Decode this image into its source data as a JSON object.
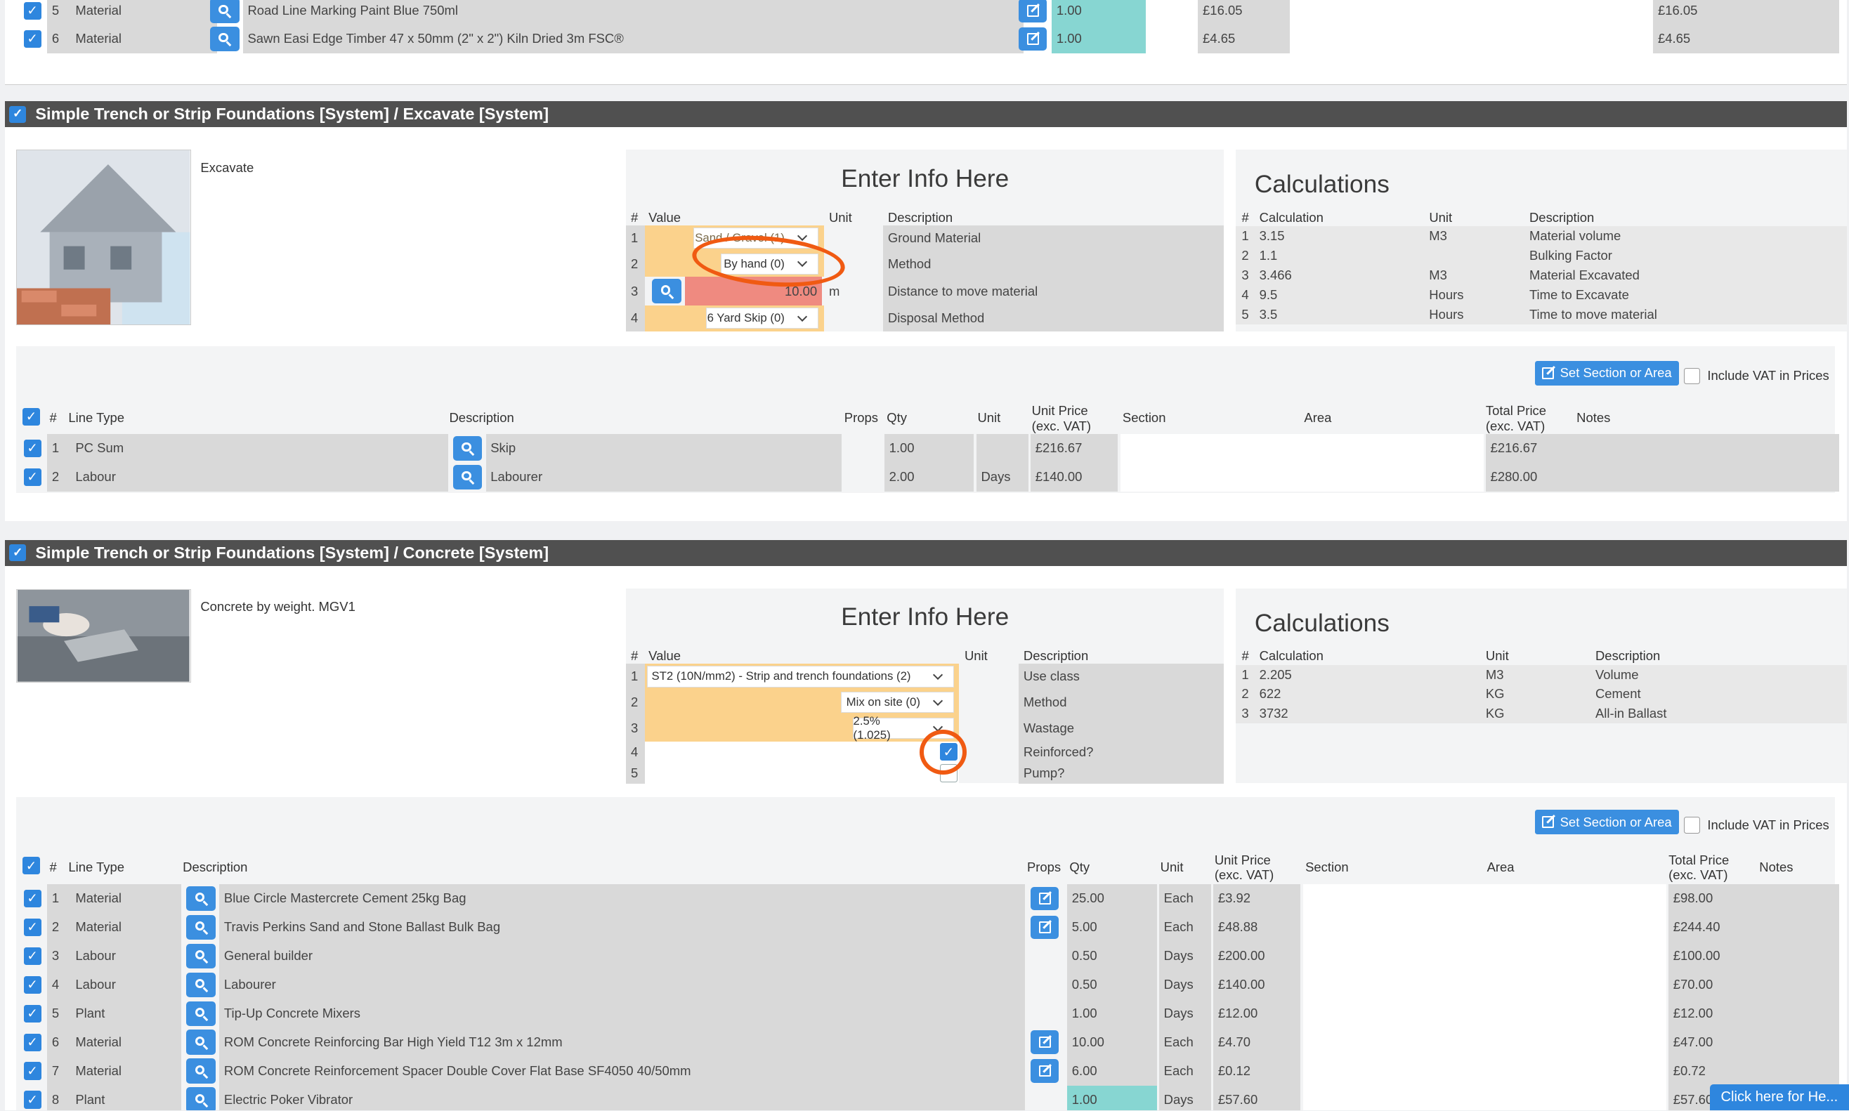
{
  "top_rows": [
    {
      "num": "5",
      "type": "Material",
      "desc": "Road Line Marking Paint Blue 750ml",
      "qty": "1.00",
      "unit_price": "£16.05",
      "total": "£16.05"
    },
    {
      "num": "6",
      "type": "Material",
      "desc": "Sawn Easi Edge Timber 47 x 50mm (2\" x 2\") Kiln Dried 3m FSC®",
      "qty": "1.00",
      "unit_price": "£4.65",
      "total": "£4.65"
    }
  ],
  "sections": [
    {
      "title": "Simple Trench or Strip Foundations [System] / Excavate [System]",
      "caption": "Excavate",
      "info_title": "Enter Info Here",
      "info_headers": {
        "num": "#",
        "value": "Value",
        "unit": "Unit",
        "description": "Description"
      },
      "info_rows": [
        {
          "num": "1",
          "value": "Sand / Gravel (1)",
          "unit": "",
          "description": "Ground Material"
        },
        {
          "num": "2",
          "value": "By hand (0)",
          "unit": "",
          "description": "Method"
        },
        {
          "num": "3",
          "value": "10.00",
          "unit": "m",
          "description": "Distance to move material"
        },
        {
          "num": "4",
          "value": "6 Yard Skip (0)",
          "unit": "",
          "description": "Disposal Method"
        }
      ],
      "calc_title": "Calculations",
      "calc_headers": {
        "num": "#",
        "calculation": "Calculation",
        "unit": "Unit",
        "description": "Description"
      },
      "calc_rows": [
        {
          "num": "1",
          "calculation": "3.15",
          "unit": "M3",
          "description": "Material volume"
        },
        {
          "num": "2",
          "calculation": "1.1",
          "unit": "",
          "description": "Bulking Factor"
        },
        {
          "num": "3",
          "calculation": "3.466",
          "unit": "M3",
          "description": "Material Excavated"
        },
        {
          "num": "4",
          "calculation": "9.5",
          "unit": "Hours",
          "description": "Time to Excavate"
        },
        {
          "num": "5",
          "calculation": "3.5",
          "unit": "Hours",
          "description": "Time to move material"
        }
      ],
      "set_button": "Set Section or Area",
      "vat_label": "Include VAT in Prices",
      "line_headers": {
        "num": "#",
        "line_type": "Line Type",
        "description": "Description",
        "props": "Props",
        "qty": "Qty",
        "unit": "Unit",
        "unit_price_1": "Unit Price",
        "unit_price_2": "(exc. VAT)",
        "section": "Section",
        "area": "Area",
        "total_1": "Total Price",
        "total_2": "(exc. VAT)",
        "notes": "Notes"
      },
      "lines": [
        {
          "num": "1",
          "type": "PC Sum",
          "desc": "Skip",
          "qty": "1.00",
          "unit": "",
          "unit_price": "£216.67",
          "total": "£216.67"
        },
        {
          "num": "2",
          "type": "Labour",
          "desc": "Labourer",
          "qty": "2.00",
          "unit": "Days",
          "unit_price": "£140.00",
          "total": "£280.00"
        }
      ]
    },
    {
      "title": "Simple Trench or Strip Foundations [System] / Concrete [System]",
      "caption": "Concrete by weight. MGV1",
      "info_title": "Enter Info Here",
      "info_headers": {
        "num": "#",
        "value": "Value",
        "unit": "Unit",
        "description": "Description"
      },
      "info_rows": [
        {
          "num": "1",
          "value": "ST2 (10N/mm2) - Strip and trench foundations (2)",
          "unit": "",
          "description": "Use class"
        },
        {
          "num": "2",
          "value": "Mix on site (0)",
          "unit": "",
          "description": "Method"
        },
        {
          "num": "3",
          "value": "2.5% (1.025)",
          "unit": "",
          "description": "Wastage"
        },
        {
          "num": "4",
          "value": "",
          "unit": "",
          "description": "Reinforced?"
        },
        {
          "num": "5",
          "value": "",
          "unit": "",
          "description": "Pump?"
        }
      ],
      "calc_title": "Calculations",
      "calc_headers": {
        "num": "#",
        "calculation": "Calculation",
        "unit": "Unit",
        "description": "Description"
      },
      "calc_rows": [
        {
          "num": "1",
          "calculation": "2.205",
          "unit": "M3",
          "description": "Volume"
        },
        {
          "num": "2",
          "calculation": "622",
          "unit": "KG",
          "description": "Cement"
        },
        {
          "num": "3",
          "calculation": "3732",
          "unit": "KG",
          "description": "All-in Ballast"
        }
      ],
      "set_button": "Set Section or Area",
      "vat_label": "Include VAT in Prices",
      "line_headers": {
        "num": "#",
        "line_type": "Line Type",
        "description": "Description",
        "props": "Props",
        "qty": "Qty",
        "unit": "Unit",
        "unit_price_1": "Unit Price",
        "unit_price_2": "(exc. VAT)",
        "section": "Section",
        "area": "Area",
        "total_1": "Total Price",
        "total_2": "(exc. VAT)",
        "notes": "Notes"
      },
      "lines": [
        {
          "num": "1",
          "type": "Material",
          "desc": "Blue Circle Mastercrete Cement 25kg Bag",
          "qty": "25.00",
          "unit": "Each",
          "unit_price": "£3.92",
          "total": "£98.00"
        },
        {
          "num": "2",
          "type": "Material",
          "desc": "Travis Perkins Sand and Stone Ballast Bulk Bag",
          "qty": "5.00",
          "unit": "Each",
          "unit_price": "£48.88",
          "total": "£244.40"
        },
        {
          "num": "3",
          "type": "Labour",
          "desc": "General builder",
          "qty": "0.50",
          "unit": "Days",
          "unit_price": "£200.00",
          "total": "£100.00"
        },
        {
          "num": "4",
          "type": "Labour",
          "desc": "Labourer",
          "qty": "0.50",
          "unit": "Days",
          "unit_price": "£140.00",
          "total": "£70.00"
        },
        {
          "num": "5",
          "type": "Plant",
          "desc": "Tip-Up Concrete Mixers",
          "qty": "1.00",
          "unit": "Days",
          "unit_price": "£12.00",
          "total": "£12.00"
        },
        {
          "num": "6",
          "type": "Material",
          "desc": "ROM Concrete Reinforcing Bar High Yield T12 3m x 12mm",
          "qty": "10.00",
          "unit": "Each",
          "unit_price": "£4.70",
          "total": "£47.00"
        },
        {
          "num": "7",
          "type": "Material",
          "desc": "ROM Concrete Reinforcement Spacer Double Cover Flat Base SF4050 40/50mm",
          "qty": "6.00",
          "unit": "Each",
          "unit_price": "£0.12",
          "total": "£0.72"
        },
        {
          "num": "8",
          "type": "Plant",
          "desc": "Electric Poker Vibrator",
          "qty": "1.00",
          "unit": "Days",
          "unit_price": "£57.60",
          "total": "£57.60"
        }
      ]
    }
  ],
  "help_button": "Click here for He...",
  "colors": {
    "accent": "#3b8fe0",
    "header": "#505050",
    "highlight": "#87d6d2",
    "orange": "#fbd28c",
    "red": "#ef8a80",
    "annotation": "#f05a12"
  },
  "icons": [
    "checkbox-icon",
    "search-icon",
    "edit-icon",
    "chevron-down-icon",
    "house-photo",
    "concrete-photo"
  ]
}
